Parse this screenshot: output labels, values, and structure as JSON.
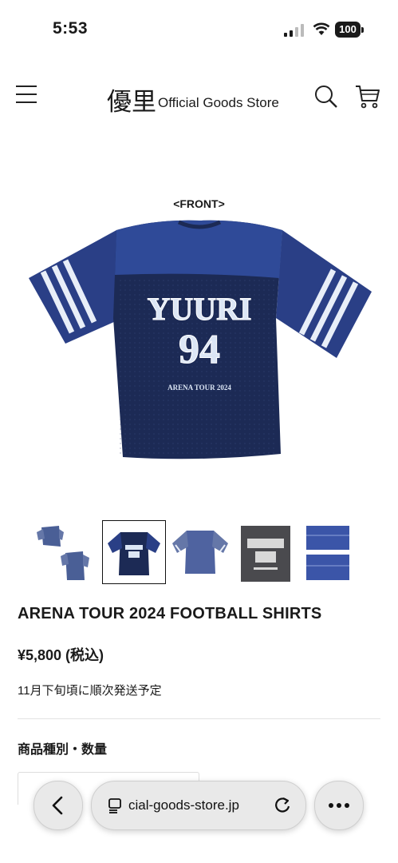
{
  "status_bar": {
    "time": "5:53",
    "battery": "100"
  },
  "header": {
    "brand_kanji": "優里",
    "brand_subtitle": "Official Goods Store"
  },
  "product": {
    "image_caption": "<FRONT>",
    "jersey_text_main": "YUURI",
    "jersey_number": "94",
    "jersey_text_small": "ARENA TOUR 2024",
    "title": "ARENA TOUR 2024 FOOTBALL SHIRTS",
    "price": "¥5,800 (税込)",
    "shipping_note": "11月下旬頃に順次発送予定",
    "options_label": "商品種別・数量"
  },
  "thumbnails": {
    "count": 5,
    "selected_index": 1
  },
  "browser": {
    "url_display": "cial-goods-store.jp"
  },
  "colors": {
    "navy_dark": "#1c2a55",
    "navy_satin": "#2a3f86",
    "stripe": "#e8eef8",
    "print": "#dce6f5"
  }
}
